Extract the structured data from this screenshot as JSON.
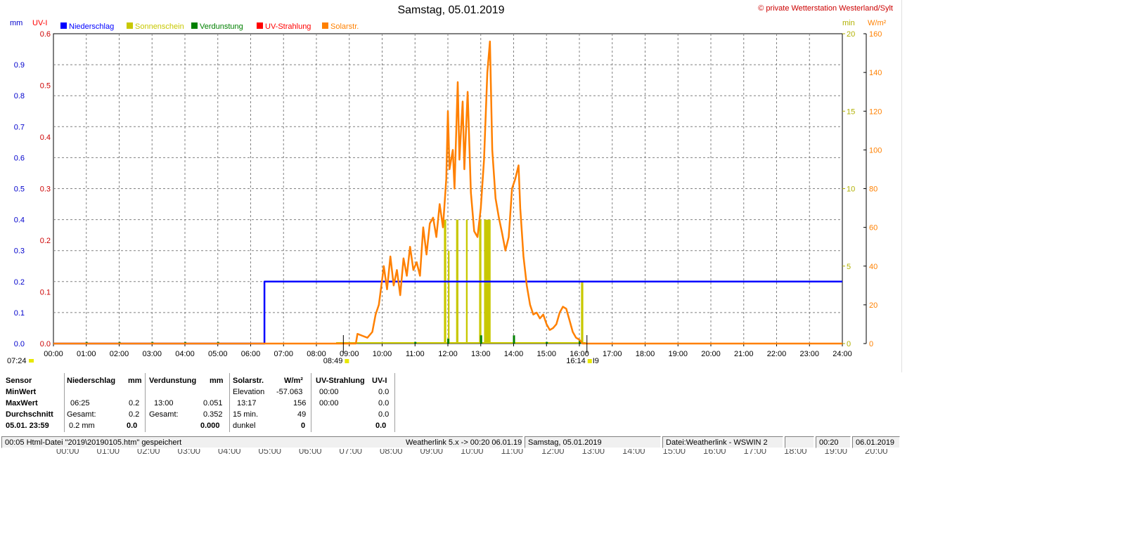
{
  "header": {
    "title": "Samstag, 05.01.2019",
    "copyright": "© private Wetterstation Westerland/Sylt"
  },
  "legend": [
    {
      "label": "Niederschlag",
      "color": "#0000ff"
    },
    {
      "label": "Sonnenschein",
      "color": "#c8c800"
    },
    {
      "label": "Verdunstung",
      "color": "#008000"
    },
    {
      "label": "UV-Strahlung",
      "color": "#ff0000"
    },
    {
      "label": "Solarstr.",
      "color": "#ff8000"
    }
  ],
  "axes": {
    "mm_unit": "mm",
    "uv_unit": "UV-I",
    "min_unit": "min",
    "wm2_unit": "W/m²",
    "mm_ticks": [
      "0.0",
      "0.1",
      "0.2",
      "0.3",
      "0.4",
      "0.5",
      "0.6",
      "0.7",
      "0.8",
      "0.9"
    ],
    "uv_ticks": [
      "0.0",
      "0.1",
      "0.2",
      "0.3",
      "0.4",
      "0.5",
      "0.6"
    ],
    "min_ticks": [
      "0",
      "5",
      "10",
      "15",
      "20"
    ],
    "wm2_ticks": [
      "0",
      "20",
      "40",
      "60",
      "80",
      "100",
      "120",
      "140",
      "160"
    ],
    "x_ticks": [
      "00:00",
      "01:00",
      "02:00",
      "03:00",
      "04:00",
      "05:00",
      "06:00",
      "07:00",
      "08:00",
      "09:00",
      "10:00",
      "11:00",
      "12:00",
      "13:00",
      "14:00",
      "15:00",
      "16:00",
      "17:00",
      "18:00",
      "19:00",
      "20:00",
      "21:00",
      "22:00",
      "23:00",
      "24:00"
    ]
  },
  "markers": {
    "sunrise_left": "07:24",
    "sunrise": "08:49",
    "sunset": "16:14",
    "sunset_suffix": "I9"
  },
  "stats": {
    "sensor": "Sensor",
    "min": "MinWert",
    "max": "MaxWert",
    "avg": "Durchschnitt",
    "date": "05.01. 23:59",
    "rain": {
      "title": "Niederschlag",
      "unit": "mm",
      "max_time": "06:25",
      "max_val": "0.2",
      "total_label": "Gesamt:",
      "total_val": "0.2",
      "sum_text": "0.2 mm",
      "sum_bold": "0.0"
    },
    "evap": {
      "title": "Verdunstung",
      "unit": "mm",
      "max_time": "13:00",
      "max_val": "0.051",
      "total_label": "Gesamt:",
      "total_val": "0.352",
      "sum_bold": "0.000"
    },
    "solar": {
      "title": "Solarstr.",
      "unit": "W/m²",
      "min_label": "Elevation",
      "min_val": "-57.063",
      "max_time": "13:17",
      "max_val": "156",
      "avg_label": "15 min.",
      "avg_val": "49",
      "dark_label": "dunkel",
      "dark_val": "0"
    },
    "uv": {
      "title": "UV-Strahlung",
      "unit": "UV-I",
      "min_time": "00:00",
      "min_val": "0.0",
      "max_time": "00:00",
      "max_val": "0.0",
      "avg_val": "0.0",
      "sum_bold": "0.0"
    }
  },
  "statusbar": {
    "s1": "00:05  Html-Datei  \"2019\\20190105.htm\"  gespeichert",
    "s1b": "Weatherlink 5.x -> 00:20  06.01.19",
    "s2": "Samstag, 05.01.2019",
    "s3": "Datei:Weatherlink - WSWIN 2",
    "s4": "",
    "s5": "00:20",
    "s6": "06.01.2019"
  },
  "ghost_ticks": [
    "00:00",
    "01:00",
    "02:00",
    "03:00",
    "04:00",
    "05:00",
    "06:00",
    "07:00",
    "08:00",
    "09:00",
    "10:00",
    "11:00",
    "12:00",
    "13:00",
    "14:00",
    "15:00",
    "16:00",
    "17:00",
    "18:00",
    "19:00",
    "20:00"
  ],
  "chart_data": {
    "type": "line",
    "xlabel": "",
    "x_range": [
      0,
      24
    ],
    "series": [
      {
        "name": "Niederschlag",
        "color": "#0000ff",
        "axis": "mm",
        "ylim": [
          0,
          1.0
        ],
        "points": [
          [
            0,
            0
          ],
          [
            6.42,
            0
          ],
          [
            6.42,
            0.2
          ],
          [
            24,
            0.2
          ]
        ]
      },
      {
        "name": "Solarstr.",
        "color": "#ff8000",
        "axis": "W/m²",
        "ylim": [
          0,
          160
        ],
        "points": [
          [
            0,
            0
          ],
          [
            9.2,
            0
          ],
          [
            9.25,
            5
          ],
          [
            9.4,
            4
          ],
          [
            9.55,
            3
          ],
          [
            9.7,
            6
          ],
          [
            9.8,
            15
          ],
          [
            9.9,
            20
          ],
          [
            10.0,
            33
          ],
          [
            10.05,
            40
          ],
          [
            10.15,
            28
          ],
          [
            10.25,
            45
          ],
          [
            10.35,
            30
          ],
          [
            10.45,
            38
          ],
          [
            10.55,
            25
          ],
          [
            10.65,
            44
          ],
          [
            10.75,
            35
          ],
          [
            10.85,
            50
          ],
          [
            10.95,
            38
          ],
          [
            11.05,
            42
          ],
          [
            11.15,
            35
          ],
          [
            11.25,
            60
          ],
          [
            11.35,
            46
          ],
          [
            11.45,
            62
          ],
          [
            11.55,
            65
          ],
          [
            11.65,
            55
          ],
          [
            11.75,
            72
          ],
          [
            11.85,
            60
          ],
          [
            11.95,
            85
          ],
          [
            12.0,
            120
          ],
          [
            12.05,
            90
          ],
          [
            12.15,
            100
          ],
          [
            12.2,
            80
          ],
          [
            12.3,
            135
          ],
          [
            12.35,
            95
          ],
          [
            12.45,
            125
          ],
          [
            12.5,
            90
          ],
          [
            12.6,
            130
          ],
          [
            12.7,
            78
          ],
          [
            12.8,
            58
          ],
          [
            12.9,
            55
          ],
          [
            13.0,
            70
          ],
          [
            13.1,
            95
          ],
          [
            13.2,
            140
          ],
          [
            13.28,
            156
          ],
          [
            13.35,
            100
          ],
          [
            13.45,
            75
          ],
          [
            13.55,
            65
          ],
          [
            13.65,
            57
          ],
          [
            13.75,
            48
          ],
          [
            13.85,
            55
          ],
          [
            13.95,
            80
          ],
          [
            14.05,
            85
          ],
          [
            14.15,
            92
          ],
          [
            14.2,
            70
          ],
          [
            14.3,
            45
          ],
          [
            14.4,
            30
          ],
          [
            14.5,
            20
          ],
          [
            14.6,
            15
          ],
          [
            14.7,
            16
          ],
          [
            14.8,
            13
          ],
          [
            14.9,
            15
          ],
          [
            15.0,
            10
          ],
          [
            15.1,
            7
          ],
          [
            15.2,
            8
          ],
          [
            15.3,
            10
          ],
          [
            15.4,
            16
          ],
          [
            15.5,
            19
          ],
          [
            15.6,
            18
          ],
          [
            15.7,
            12
          ],
          [
            15.8,
            6
          ],
          [
            15.9,
            3
          ],
          [
            16.0,
            2
          ],
          [
            16.1,
            0
          ],
          [
            24,
            0
          ]
        ]
      }
    ],
    "sunshine_bars": [
      [
        11.88,
        11.95,
        8
      ],
      [
        12.0,
        12.05,
        6
      ],
      [
        12.25,
        12.32,
        8
      ],
      [
        12.55,
        12.6,
        8
      ],
      [
        12.95,
        13.02,
        8
      ],
      [
        13.1,
        13.3,
        8
      ],
      [
        16.05,
        16.12,
        4
      ]
    ],
    "evaporation_ticks": [
      [
        1.0,
        0.01
      ],
      [
        2.0,
        0.01
      ],
      [
        3.0,
        0.01
      ],
      [
        4.0,
        0.01
      ],
      [
        5.0,
        0.01
      ],
      [
        11.0,
        0.01
      ],
      [
        12.0,
        0.03
      ],
      [
        13.0,
        0.051
      ],
      [
        14.0,
        0.051
      ],
      [
        15.0,
        0.01
      ],
      [
        16.0,
        0.02
      ]
    ]
  }
}
